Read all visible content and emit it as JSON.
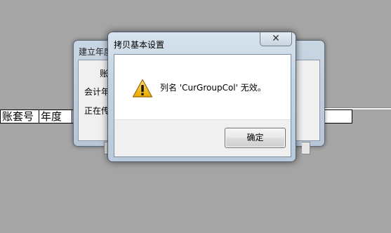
{
  "background_table": {
    "columns": [
      "账套号",
      "年度"
    ]
  },
  "background_dialog": {
    "title": "建立年度",
    "label_account": "账",
    "label_fiscal_year": "会计年",
    "label_status": "正在传"
  },
  "dialog": {
    "title": "拷贝基本设置",
    "close_glyph": "✕",
    "message": "列名 'CurGroupCol' 无效。",
    "ok_label": "确定",
    "icon": "warning-icon"
  },
  "colors": {
    "desktop": "#a5a5a5",
    "warning_fill": "#f6c300"
  }
}
